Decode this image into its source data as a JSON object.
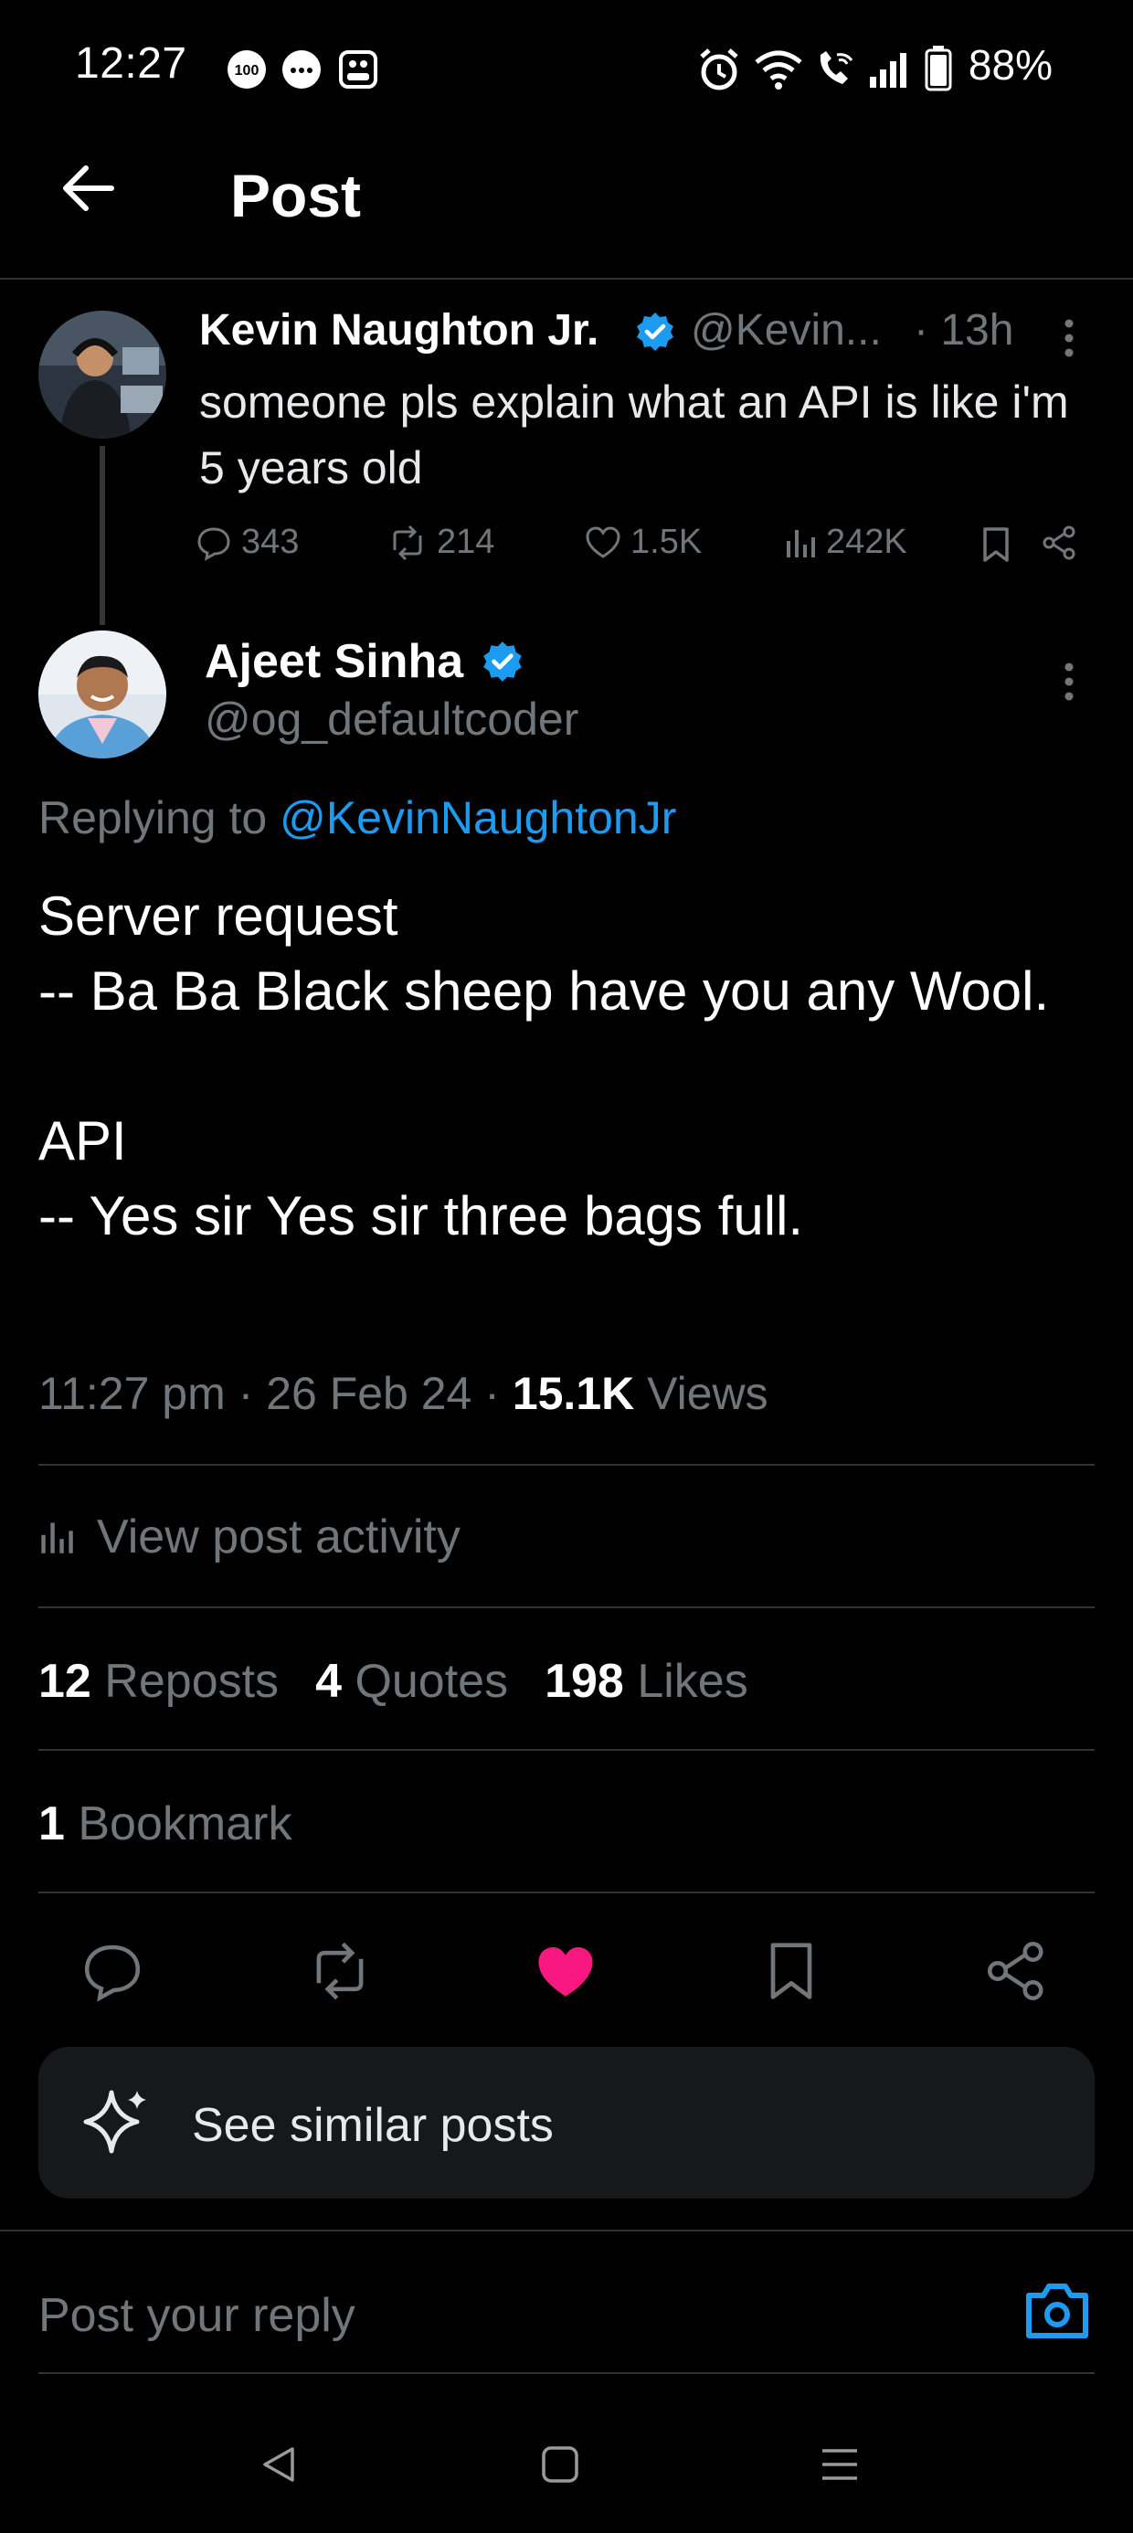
{
  "status_bar": {
    "time": "12:27",
    "notification_badge": "100",
    "battery": "88%",
    "icons": [
      "notification-count-icon",
      "chat-icon",
      "gallery-icon",
      "alarm-icon",
      "wifi-icon",
      "wifi-call-icon",
      "signal-icon",
      "battery-icon"
    ]
  },
  "header": {
    "title": "Post",
    "back_icon": "arrow-left-icon"
  },
  "parent_post": {
    "author_name": "Kevin Naughton Jr.",
    "verified": true,
    "handle": "@Kevin...",
    "time": "· 13h",
    "text": "someone pls explain what an API is like i'm 5 years old",
    "stats": {
      "replies": "343",
      "reposts": "214",
      "likes": "1.5K",
      "views": "242K"
    }
  },
  "main_post": {
    "author_name": "Ajeet Sinha",
    "verified": true,
    "handle": "@og_defaultcoder",
    "replying_prefix": "Replying to",
    "replying_handle": "@KevinNaughtonJr",
    "text": "Server request\n-- Ba Ba Black sheep have you any Wool.\n\nAPI\n-- Yes sir Yes sir three bags full.",
    "timestamp": "11:27 pm · 26 Feb 24 · ",
    "views_count": "15.1K",
    "views_label": " Views",
    "activity_label": "View post activity",
    "reposts_count": "12",
    "reposts_label": "Reposts",
    "quotes_count": "4",
    "quotes_label": "Quotes",
    "likes_count": "198",
    "likes_label": "Likes",
    "bookmark_count": "1",
    "bookmark_label": "Bookmark",
    "liked": true
  },
  "similar_posts": {
    "label": "See similar posts"
  },
  "reply_box": {
    "placeholder": "Post your reply"
  },
  "colors": {
    "background": "#000000",
    "accent": "#1d9bf0",
    "like": "#f91880",
    "muted": "#71767b",
    "divider": "#2f3336"
  }
}
